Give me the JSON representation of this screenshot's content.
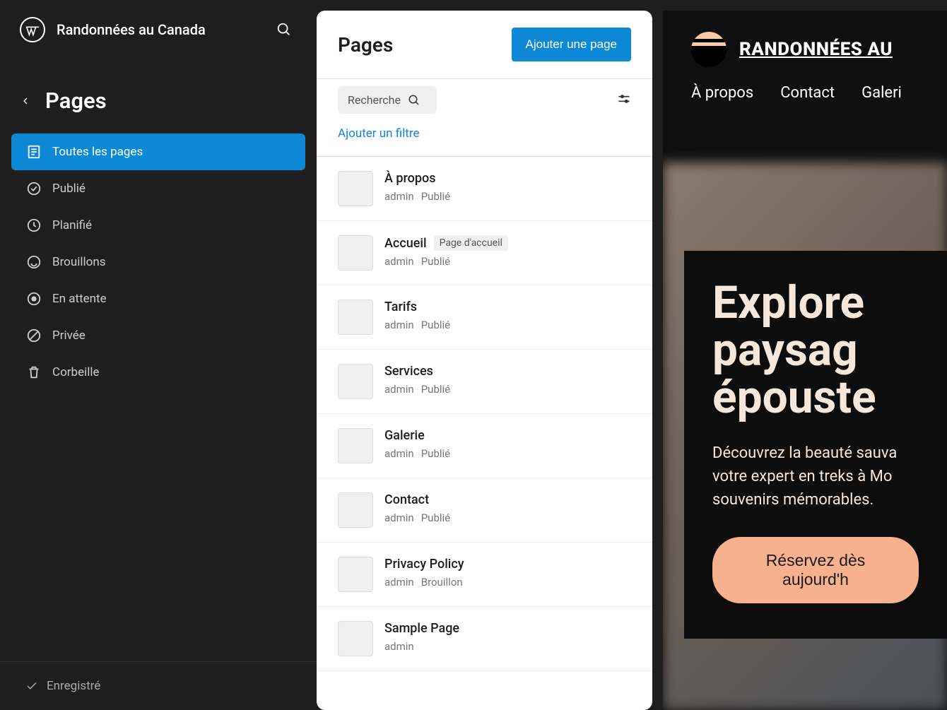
{
  "site": {
    "title": "Randonnées au Canada"
  },
  "sidebar": {
    "navTitle": "Pages",
    "items": [
      {
        "label": "Toutes les pages"
      },
      {
        "label": "Publié"
      },
      {
        "label": "Planifié"
      },
      {
        "label": "Brouillons"
      },
      {
        "label": "En attente"
      },
      {
        "label": "Privée"
      },
      {
        "label": "Corbeille"
      }
    ],
    "footer": "Enregistré"
  },
  "panel": {
    "title": "Pages",
    "addButton": "Ajouter une page",
    "searchPlaceholder": "Recherche",
    "addFilter": "Ajouter un filtre",
    "pages": [
      {
        "title": "À propos",
        "author": "admin",
        "status": "Publié",
        "badge": ""
      },
      {
        "title": "Accueil",
        "author": "admin",
        "status": "Publié",
        "badge": "Page d'accueil"
      },
      {
        "title": "Tarifs",
        "author": "admin",
        "status": "Publié",
        "badge": ""
      },
      {
        "title": "Services",
        "author": "admin",
        "status": "Publié",
        "badge": ""
      },
      {
        "title": "Galerie",
        "author": "admin",
        "status": "Publié",
        "badge": ""
      },
      {
        "title": "Contact",
        "author": "admin",
        "status": "Publié",
        "badge": ""
      },
      {
        "title": "Privacy Policy",
        "author": "admin",
        "status": "Brouillon",
        "badge": ""
      },
      {
        "title": "Sample Page",
        "author": "admin",
        "status": "",
        "badge": ""
      }
    ]
  },
  "preview": {
    "siteTitle": "RANDONNÉES AU",
    "nav": [
      {
        "label": "À propos"
      },
      {
        "label": "Contact"
      },
      {
        "label": "Galeri"
      }
    ],
    "heroTitle": "Explore paysag épouste",
    "heroText": "Découvrez la beauté sauva votre expert en treks à Mo souvenirs mémorables.",
    "cta": "Réservez dès aujourd'h"
  }
}
